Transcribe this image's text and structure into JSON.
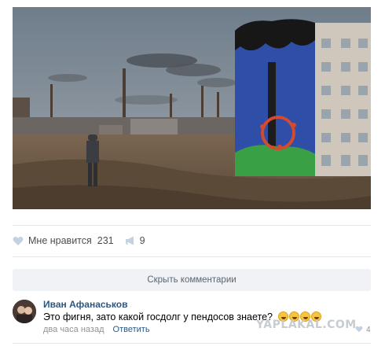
{
  "post": {
    "photo_alt": "",
    "actions": {
      "like_label": "Мне нравится",
      "like_count": "231",
      "share_count": "9"
    }
  },
  "comments_toggle": {
    "label": "Скрыть комментарии"
  },
  "comment": {
    "author": "Иван Афанаськов",
    "text": "Это фигня, зато какой госдолг у пендосов знаете?",
    "emoji": [
      "laughing-tears-emoji",
      "laughing-tears-emoji",
      "laughing-tears-emoji",
      "laughing-tears-emoji"
    ],
    "time": "два часа назад",
    "reply_label": "Ответить",
    "likes": "4"
  },
  "watermark": "YAPLAKAL.COM",
  "colors": {
    "link": "#2a5885",
    "muted": "#939393",
    "toggle_bg": "#f0f2f5",
    "divider": "#e7e8ec"
  },
  "icons": {
    "like": "heart-icon",
    "share": "megaphone-icon"
  }
}
